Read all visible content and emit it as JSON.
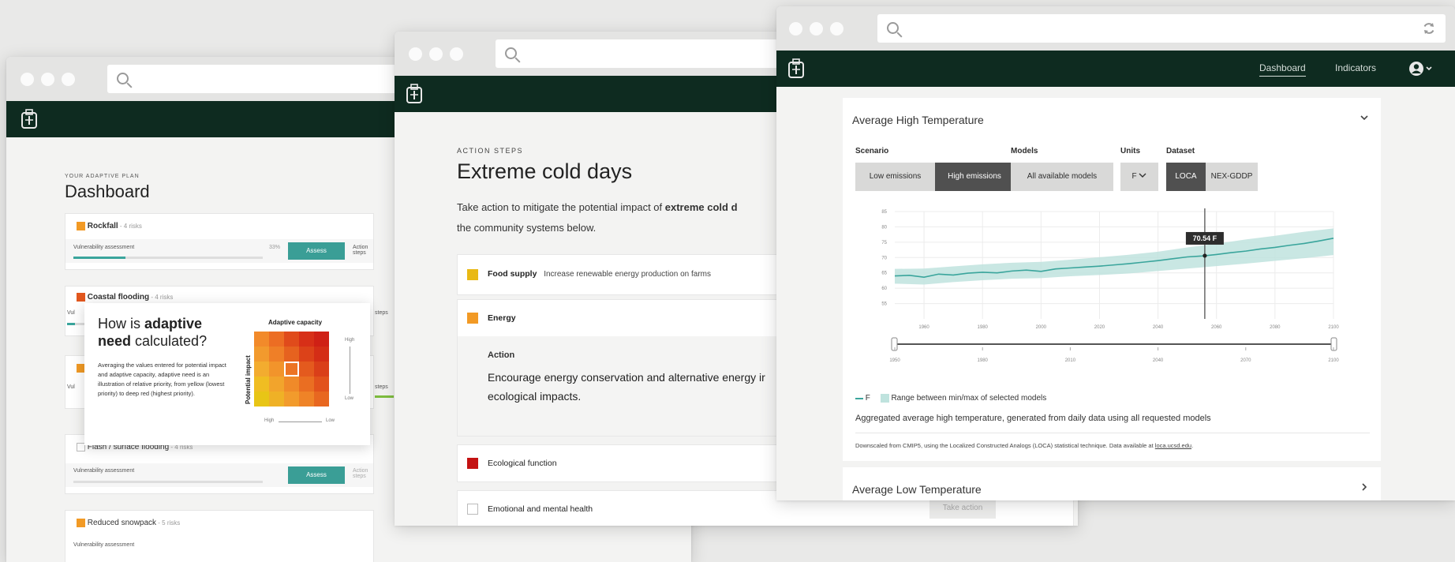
{
  "dashboard_window": {
    "eyebrow": "YOUR ADAPTIVE PLAN",
    "title": "Dashboard",
    "risks": [
      {
        "name": "Rockfall",
        "meta": " - 4 risks",
        "color": "#f29a25",
        "filled": true,
        "vuln_label": "Vulnerability assessment",
        "pct": "33%",
        "progress": 0.33,
        "action_label": "Assess",
        "steps_label": "Action steps"
      },
      {
        "name": "Coastal flooding",
        "meta": " - 4 risks",
        "color": "#e2571e",
        "filled": true
      },
      {
        "name": "",
        "meta": "",
        "color": "#f29a25",
        "filled": true
      },
      {
        "name": "Flash / surface flooding",
        "meta": " - 4 risks",
        "color": "#ffffff",
        "filled": false,
        "vuln_label": "Vulnerability assessment",
        "progress": 0,
        "action_label": "Assess",
        "steps_label": "Action steps"
      },
      {
        "name": "Reduced snowpack",
        "meta": " - 5 risks",
        "color": "#f29a25",
        "filled": true,
        "vuln_label": "Vulnerability assessment"
      }
    ],
    "partial_labels": [
      "Vul",
      "Vul",
      "steps",
      "steps"
    ],
    "tooltip": {
      "title_plain_1": "How is ",
      "title_bold": "adaptive need",
      "title_plain_2": " calculated?",
      "body": "Averaging the values entered for potential impact and adaptive capacity, adaptive need is an illustration of relative priority, from yellow (lowest priority) to deep red (highest priority).",
      "x_axis": "Adaptive capacity",
      "y_axis": "Potential impact",
      "high": "High",
      "low": "Low",
      "x_high": "High",
      "x_low": "Low",
      "grid_colors": [
        [
          "#f28a2a",
          "#ec6d23",
          "#e04b1b",
          "#d72f17",
          "#cf2015"
        ],
        [
          "#f29a2d",
          "#ef7f27",
          "#e6621f",
          "#dc4219",
          "#d42d16"
        ],
        [
          "#f3ac2f",
          "#f2942b",
          "#ec7424",
          "#e45a1e",
          "#da3f19"
        ],
        [
          "#f0bd22",
          "#f2a42c",
          "#f08a29",
          "#ea6e22",
          "#e2521c"
        ],
        [
          "#e8c516",
          "#efb126",
          "#f29b2c",
          "#ef8327",
          "#e86720"
        ]
      ]
    }
  },
  "action_window": {
    "eyebrow": "ACTION STEPS",
    "title": "Extreme cold days",
    "intro_1": "Take action to mitigate the potential impact of ",
    "intro_bold": "extreme cold d",
    "intro_2": "the community systems below.",
    "rows": [
      {
        "label": "Food supply",
        "desc": "Increase renewable energy production on farms",
        "color": "#e9b914"
      },
      {
        "label": "Energy",
        "desc": "",
        "color": "#f29a25"
      },
      {
        "label": "Ecological function",
        "desc": "",
        "color": "#c41212"
      },
      {
        "label": "Emotional and mental health",
        "desc": "",
        "color": "#ffffff"
      }
    ],
    "action_heading": "Action",
    "action_text_1": "Encourage energy conservation and alternative energy ir",
    "action_text_2": "ecological impacts.",
    "take_action": "Take action"
  },
  "indicators_window": {
    "nav": {
      "dashboard": "Dashboard",
      "indicators": "Indicators"
    },
    "panel_title": "Average High Temperature",
    "controls": {
      "scenario_label": "Scenario",
      "scenarios": [
        "Low emissions",
        "High emissions"
      ],
      "scenario_selected": "High emissions",
      "models_label": "Models",
      "models_value": "All available models",
      "units_label": "Units",
      "units_value": "F",
      "dataset_label": "Dataset",
      "datasets": [
        "LOCA",
        "NEX-GDDP"
      ],
      "dataset_selected": "LOCA"
    },
    "tooltip_value": "70.54 F",
    "legend_series": "F",
    "legend_range": "Range between min/max of selected models",
    "caption": "Aggregated average high temperature, generated from daily data using all requested models",
    "source_prefix": "Downscaled from CMIP5, using the Localized Constructed Analogs (LOCA) statistical technique. Data available at ",
    "source_link": "loca.ucsd.edu",
    "source_suffix": ".",
    "next_panel": "Average Low Temperature",
    "colors": {
      "line": "#3aa59c",
      "band": "#bfe3de",
      "nav": "#0e2b20"
    }
  },
  "chart_data": {
    "type": "line",
    "xlim": [
      1950,
      2100
    ],
    "ylim": [
      50,
      85
    ],
    "x_ticks": [
      "1960",
      "1980",
      "2000",
      "2020",
      "2040",
      "2060",
      "2080",
      "2100"
    ],
    "y_ticks": [
      "85",
      "80",
      "75",
      "70",
      "65",
      "60",
      "55"
    ],
    "series": [
      {
        "name": "F",
        "x": [
          1950,
          1955,
          1960,
          1965,
          1970,
          1975,
          1980,
          1985,
          1990,
          1995,
          2000,
          2005,
          2010,
          2015,
          2020,
          2025,
          2030,
          2035,
          2040,
          2045,
          2050,
          2055,
          2060,
          2065,
          2070,
          2075,
          2080,
          2085,
          2090,
          2095,
          2100
        ],
        "y": [
          64.0,
          64.2,
          63.6,
          64.6,
          64.3,
          64.9,
          65.2,
          65.0,
          65.6,
          65.9,
          65.5,
          66.3,
          66.6,
          66.9,
          67.2,
          67.6,
          68.0,
          68.5,
          69.0,
          69.6,
          70.2,
          70.5,
          71.0,
          71.6,
          72.1,
          72.8,
          73.3,
          74.0,
          74.6,
          75.4,
          76.3
        ]
      }
    ],
    "band": {
      "x": [
        1950,
        1960,
        1970,
        1980,
        1990,
        2000,
        2010,
        2020,
        2030,
        2040,
        2050,
        2060,
        2070,
        2080,
        2090,
        2100
      ],
      "low": [
        61.5,
        61.2,
        62.0,
        62.6,
        63.1,
        63.3,
        63.9,
        64.3,
        64.8,
        65.6,
        66.4,
        67.2,
        68.0,
        68.9,
        69.8,
        70.8
      ],
      "high": [
        66.3,
        66.4,
        67.1,
        67.8,
        68.3,
        68.6,
        69.3,
        70.1,
        70.9,
        71.9,
        73.3,
        74.5,
        75.9,
        77.1,
        78.4,
        79.5
      ]
    },
    "cursor_x": 2056,
    "brush_ticks": [
      "1950",
      "1980",
      "2010",
      "2040",
      "2070",
      "2100"
    ]
  }
}
